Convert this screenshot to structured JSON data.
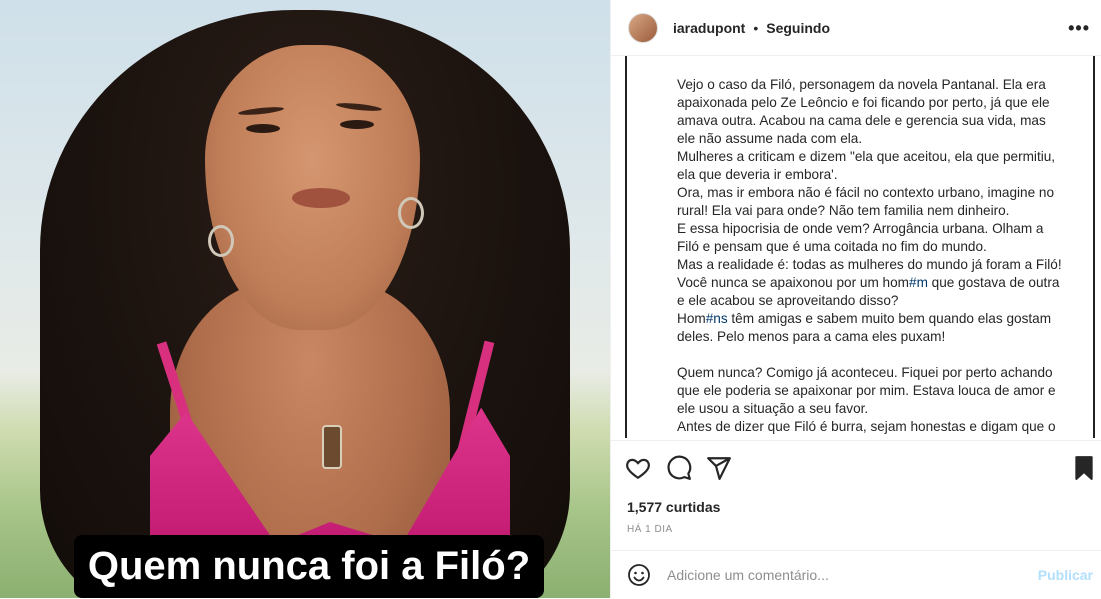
{
  "media": {
    "overlay_text": "Quem nunca foi a Filó?"
  },
  "header": {
    "username": "iaradupont",
    "separator": "•",
    "follow_status": "Seguindo",
    "more_icon": "•••"
  },
  "caption": {
    "paragraphs": [
      "Vejo o caso da Filó, personagem da novela Pantanal. Ela era apaixonada pelo Ze Leôncio e foi ficando por perto, já que ele amava outra. Acabou na cama dele e gerencia sua vida, mas ele não assume nada com ela.",
      "Mulheres a criticam e dizem \"ela que aceitou, ela que permitiu, ela que deveria ir embora'.",
      "Ora, mas ir embora não é fácil no contexto urbano, imagine no rural! Ela vai para onde? Não tem familia nem dinheiro.",
      "E essa hipocrisia de onde vem? Arrogância urbana. Olham a Filó e pensam que é uma coitada no fim do mundo.",
      "Mas a realidade é: todas as mulheres do mundo já foram a Filó!"
    ],
    "line_hom_a": "Você nunca se apaixonou por um hom",
    "hashtag_m": "#m",
    "line_hom_b": " que gostava de outra e ele acabou se aproveitando disso?",
    "line_homns_a": "Hom",
    "hashtag_ns": "#ns",
    "line_homns_b": " têm amigas e sabem muito bem quando elas gostam deles. Pelo menos para a cama eles puxam!",
    "paragraph2": "Quem nunca? Comigo já aconteceu. Fiquei por perto achando que ele poderia se apaixonar por mim. Estava louca de amor e ele usou a situação a seu favor.",
    "paragraph3": "Antes de dizer que Filó é burra, sejam honestas e digam que o"
  },
  "actions": {
    "like_icon": "heart-icon",
    "comment_icon": "comment-icon",
    "share_icon": "paper-plane-icon",
    "save_icon": "bookmark-icon"
  },
  "stats": {
    "likes": "1,577 curtidas",
    "time": "HÁ 1 DIA"
  },
  "comment": {
    "placeholder": "Adicione um comentário...",
    "publish_label": "Publicar"
  }
}
